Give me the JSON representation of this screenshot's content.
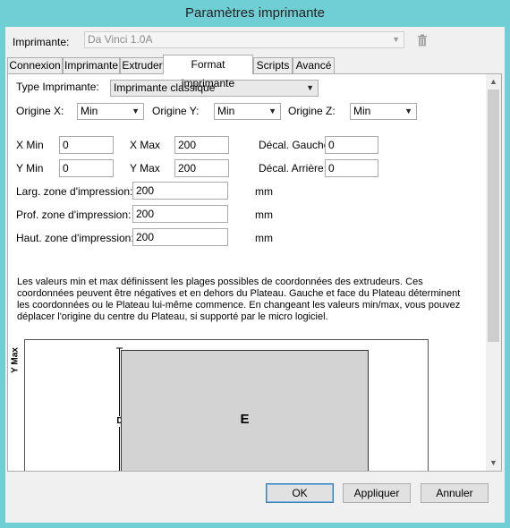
{
  "window": {
    "title": "Paramètres imprimante"
  },
  "printer": {
    "label": "Imprimante:",
    "value": "Da Vinci 1.0A",
    "delete_icon": "trash-icon"
  },
  "tabs": [
    {
      "label": "Connexion"
    },
    {
      "label": "Imprimante"
    },
    {
      "label": "Extruder"
    },
    {
      "label": "Format imprimante",
      "active": true
    },
    {
      "label": "Scripts"
    },
    {
      "label": "Avancé"
    }
  ],
  "form": {
    "type_label": "Type Imprimante:",
    "type_value": "Imprimante classique",
    "origin_x_label": "Origine X:",
    "origin_x_value": "Min",
    "origin_y_label": "Origine Y:",
    "origin_y_value": "Min",
    "origin_z_label": "Origine Z:",
    "origin_z_value": "Min",
    "xmin_label": "X Min",
    "xmin_value": "0",
    "xmax_label": "X Max",
    "xmax_value": "200",
    "decal_gauche_label": "Décal. Gauche:",
    "decal_gauche_value": "0",
    "ymin_label": "Y Min",
    "ymin_value": "0",
    "ymax_label": "Y Max",
    "ymax_value": "200",
    "decal_arriere_label": "Décal. Arrière:",
    "decal_arriere_value": "0",
    "larg_label": "Larg. zone d'impression:",
    "larg_value": "200",
    "larg_unit": "mm",
    "prof_label": "Prof. zone d'impression:",
    "prof_value": "200",
    "prof_unit": "mm",
    "haut_label": "Haut. zone d'impression:",
    "haut_value": "200",
    "haut_unit": "mm",
    "description": "Les valeurs min et max définissent les plages possibles de coordonnées des extrudeurs. Ces coordonnées peuvent être négatives et en dehors du Plateau. Gauche et face du Plateau déterminent les coordonnées ou le Plateau lui-même commence. En changeant les valeurs min/max, vous pouvez déplacer l'origine du centre du Plateau, si supporté par le micro logiciel."
  },
  "diagram": {
    "ymax_label": "Y Max",
    "d_label": "D",
    "e_label": "E"
  },
  "buttons": {
    "ok": "OK",
    "apply": "Appliquer",
    "cancel": "Annuler"
  },
  "colors": {
    "title_bar": "#6fcfd5",
    "plate": "#d3d3d3"
  }
}
